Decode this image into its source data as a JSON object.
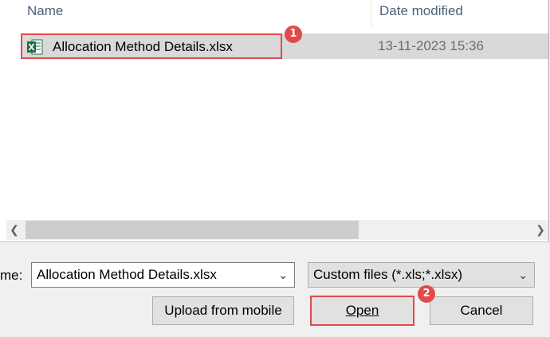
{
  "columns": {
    "name": "Name",
    "date_modified": "Date modified"
  },
  "files": [
    {
      "name": "Allocation Method Details.xlsx",
      "date_modified": "13-11-2023 15:36",
      "icon": "excel-file-icon"
    }
  ],
  "annotations": {
    "step1": "1",
    "step2": "2"
  },
  "scrollbar": {
    "left_arrow": "<",
    "right_arrow": ">"
  },
  "footer": {
    "filename_label": "me:",
    "filename_value": "Allocation Method Details.xlsx",
    "filter_value": "Custom files (*.xls;*.xlsx)",
    "upload_label": "Upload from mobile",
    "open_label": "Open",
    "cancel_label": "Cancel"
  },
  "colors": {
    "highlight": "#e04b4b",
    "selected_row": "#d9d9d9",
    "excel_green": "#1d6f42"
  }
}
